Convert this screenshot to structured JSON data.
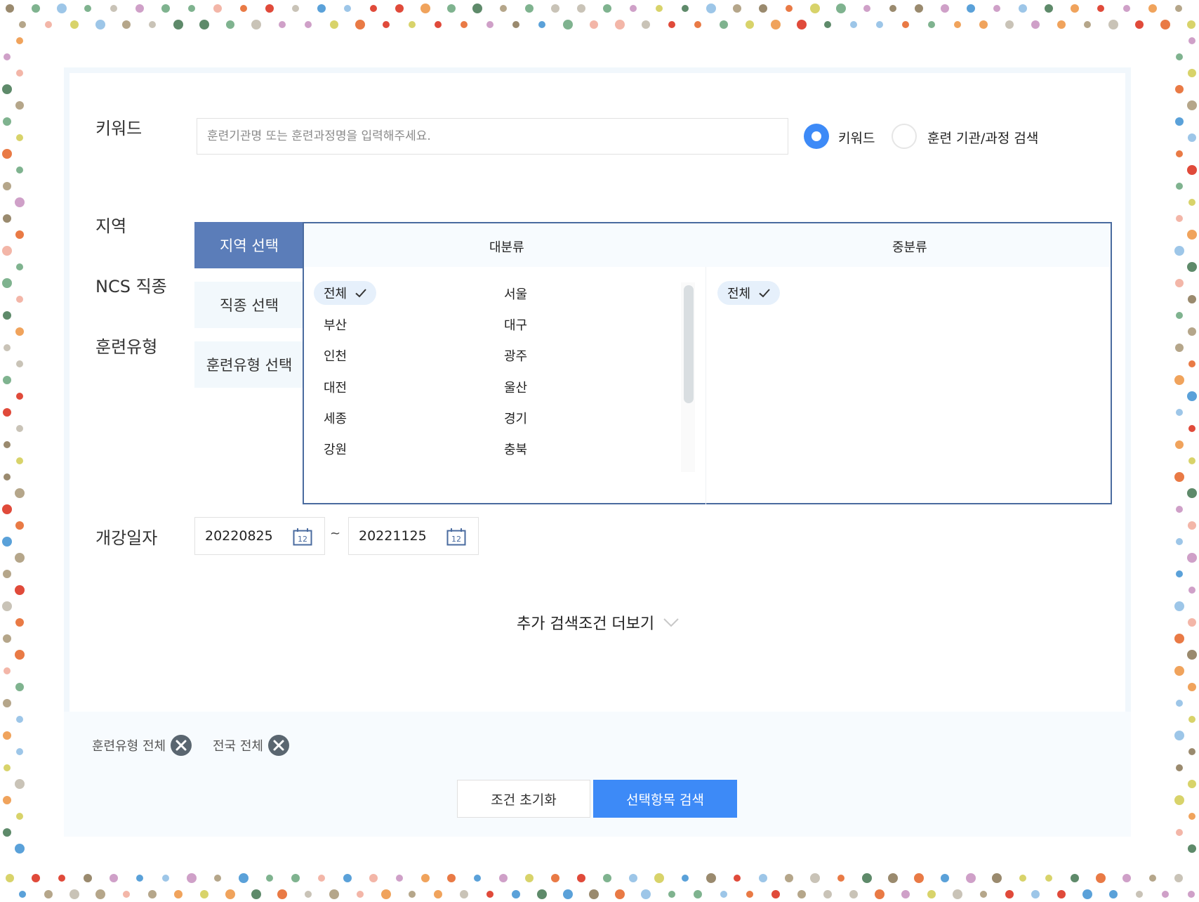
{
  "colors": {
    "accent": "#3d8af7",
    "active_tab": "#5b7db9",
    "region_border": "#4a6b9f",
    "panel_tint": "#f7fbfe",
    "dot_palette": [
      "#e04a3a",
      "#f0a35c",
      "#9dc6e8",
      "#b5a68a",
      "#cfa0c8",
      "#7fb38f",
      "#d8d36a",
      "#9a8a6e",
      "#5e8a6a",
      "#e97a45",
      "#f3b6a8",
      "#5aa1d9",
      "#c9c3b7"
    ]
  },
  "keyword": {
    "label": "키워드",
    "input_placeholder": "훈련기관명 또는 훈련과정명을 입력해주세요.",
    "radio_keyword": "키워드",
    "radio_keyword_selected": true,
    "radio_org": "훈련 기관/과정 검색",
    "radio_org_selected": false
  },
  "filters": {
    "region_label": "지역",
    "ncs_label": "NCS 직종",
    "type_label": "훈련유형",
    "tabs": [
      "지역 선택",
      "직종 선택",
      "훈련유형 선택"
    ],
    "active_tab": "지역 선택"
  },
  "region_panel": {
    "major_header": "대분류",
    "minor_header": "중분류",
    "major_items": [
      "전체",
      "서울",
      "부산",
      "대구",
      "인천",
      "광주",
      "대전",
      "울산",
      "세종",
      "경기",
      "강원",
      "충북"
    ],
    "selected_major": "전체",
    "minor_items": [
      "전체"
    ],
    "selected_minor": "전체"
  },
  "dates": {
    "label": "개강일자",
    "start": "20220825",
    "end": "20221125",
    "separator": "~",
    "calendar_icon_text": "12"
  },
  "more_conditions": "추가 검색조건 더보기",
  "selected_tags": [
    "훈련유형 전체",
    "전국 전체"
  ],
  "buttons": {
    "reset": "조건 초기화",
    "search": "선택항목 검색"
  }
}
